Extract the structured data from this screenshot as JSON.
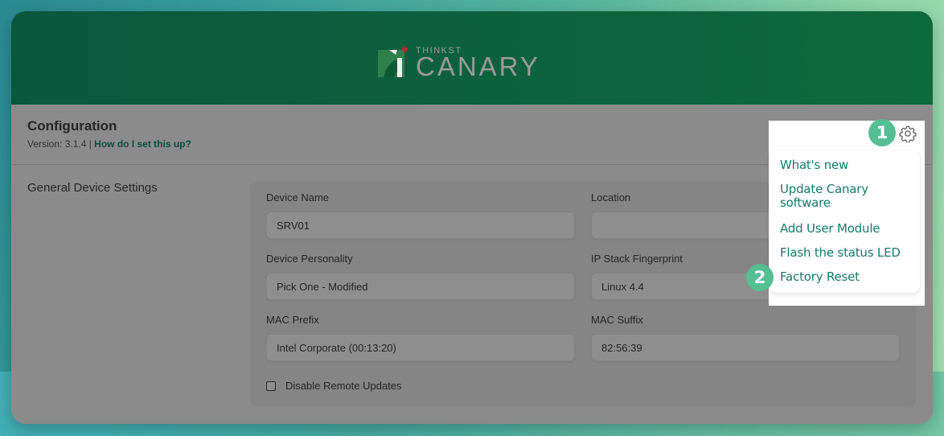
{
  "header": {
    "logo_small": "THINKST",
    "logo_big": "CANARY"
  },
  "config": {
    "title": "Configuration",
    "version_text": "Version: 3.1.4 | ",
    "help_link": "How do I set this up?"
  },
  "section": {
    "title": "General Device Settings"
  },
  "fields": {
    "device_name": {
      "label": "Device Name",
      "value": "SRV01"
    },
    "location": {
      "label": "Location",
      "value": ""
    },
    "device_personality": {
      "label": "Device Personality",
      "value": "Pick One - Modified"
    },
    "ip_stack": {
      "label": "IP Stack Fingerprint",
      "value": "Linux 4.4"
    },
    "mac_prefix": {
      "label": "MAC Prefix",
      "value": "Intel Corporate (00:13:20)"
    },
    "mac_suffix": {
      "label": "MAC Suffix",
      "value": "82:56:39"
    },
    "disable_updates": {
      "label": "Disable Remote Updates",
      "checked": false
    }
  },
  "menu": {
    "items": [
      {
        "label": "What's new"
      },
      {
        "label": "Update Canary software"
      },
      {
        "label": "Add User Module"
      },
      {
        "label": "Flash the status LED"
      },
      {
        "label": "Factory Reset"
      }
    ]
  },
  "annotations": {
    "step1": "1",
    "step2": "2",
    "color": "#56be93"
  },
  "colors": {
    "header_green": "#0d6a3c",
    "link_green": "#167a6b",
    "logo_red": "#c0282d"
  }
}
